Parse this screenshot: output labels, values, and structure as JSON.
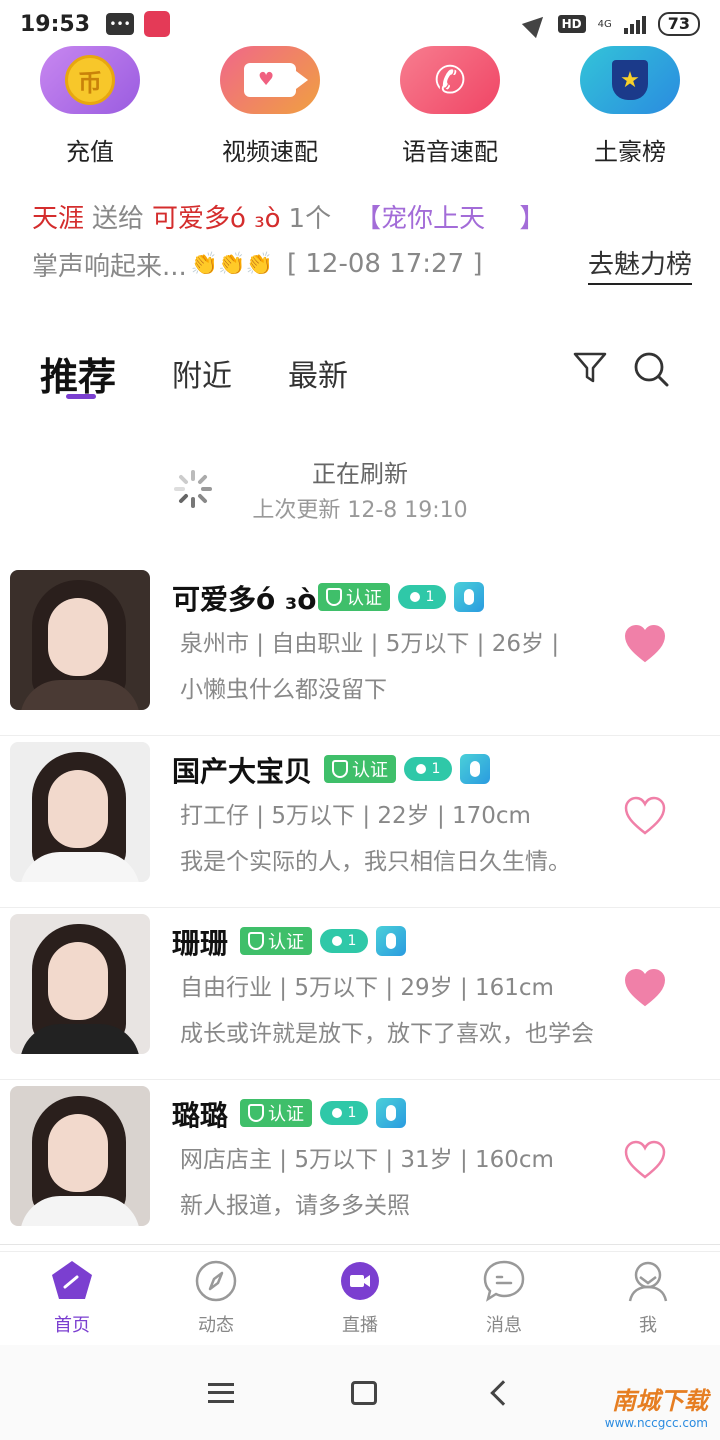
{
  "status_bar": {
    "time": "19:53",
    "network": "4G",
    "hd": "HD",
    "battery": "73"
  },
  "quick_actions": [
    {
      "label": "充值",
      "glyph": "币"
    },
    {
      "label": "视频速配"
    },
    {
      "label": "语音速配"
    },
    {
      "label": "土豪榜"
    }
  ],
  "ticker": {
    "sender": "天涯",
    "verb": "送给",
    "receiver": "可爱多ό ₃ò",
    "count": "1个",
    "gift": "【宠你上天　 】",
    "applause": "掌声响起来...",
    "clap": "👏👏👏",
    "time": "[ 12-08 17:27 ]",
    "charm_link": "去魅力榜"
  },
  "tabs": [
    {
      "label": "推荐",
      "active": true
    },
    {
      "label": "附近",
      "active": false
    },
    {
      "label": "最新",
      "active": false
    }
  ],
  "refresh": {
    "title": "正在刷新",
    "subtitle": "上次更新 12-8 19:10"
  },
  "badges": {
    "verify": "认证",
    "level": "1"
  },
  "users": [
    {
      "name": "可爱多ό ₃ò",
      "info": "泉州市 | 自由职业 | 5万以下 | 26岁 |",
      "bio": "小懒虫什么都没留下",
      "liked": true
    },
    {
      "name": "国产大宝贝",
      "info": "打工仔 | 5万以下 | 22岁 | 170cm",
      "bio": "我是个实际的人，我只相信日久生情。",
      "liked": false
    },
    {
      "name": "珊珊",
      "info": "自由行业 | 5万以下 | 29岁 | 161cm",
      "bio": "成长或许就是放下，放下了喜欢，也学会",
      "liked": true
    },
    {
      "name": "璐璐",
      "info": "网店店主 | 5万以下 | 31岁 | 160cm",
      "bio": "新人报道，请多多关照",
      "liked": false
    }
  ],
  "bottom_nav": [
    {
      "label": "首页",
      "active": true
    },
    {
      "label": "动态",
      "active": false
    },
    {
      "label": "直播",
      "active": false
    },
    {
      "label": "消息",
      "active": false
    },
    {
      "label": "我",
      "active": false
    }
  ],
  "watermark": {
    "main": "南城下载",
    "sub": "www.nccgcc.com"
  },
  "colors": {
    "accent": "#7b3fd0",
    "like": "#f080a8",
    "verify": "#3fbf6a",
    "ticker_red": "#d42d2d"
  }
}
